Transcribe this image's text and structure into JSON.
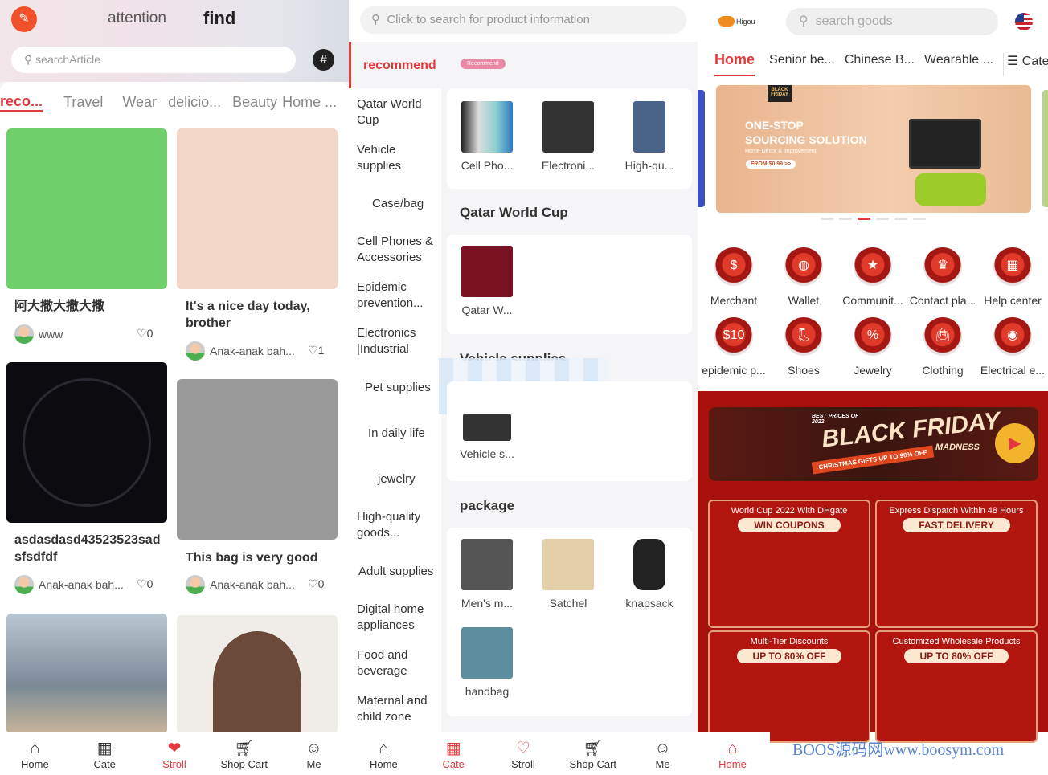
{
  "discover": {
    "header": {
      "tab_attention": "attention",
      "tab_find": "find",
      "search_placeholder": "searchArticle"
    },
    "categories": [
      "reco...",
      "Travel",
      "Wear",
      "delicio...",
      "Beauty",
      "Home ..."
    ],
    "posts": [
      {
        "title": "阿大撒大撒大撒",
        "author": "www",
        "likes": "0",
        "color": "#6fcf6a"
      },
      {
        "title": "It's a nice day today, brother",
        "author": "Anak-anak bah...",
        "likes": "1",
        "color": "#f1d6c6"
      },
      {
        "title": "asdasdasd43523523sadsfsdfdf",
        "author": "Anak-anak bah...",
        "likes": "0",
        "color": "#0c0c10"
      },
      {
        "title": "This bag is very good",
        "author": "Anak-anak bah...",
        "likes": "0",
        "color": "#9a9a9a"
      },
      {
        "title": "",
        "author": "",
        "likes": "",
        "color": "#7a8a96"
      },
      {
        "title": "",
        "author": "",
        "likes": "",
        "color": "#d9cfc8"
      }
    ],
    "nav": [
      {
        "label": "Home",
        "icon": "home-icon"
      },
      {
        "label": "Cate",
        "icon": "grid-icon"
      },
      {
        "label": "Stroll",
        "icon": "heart-icon",
        "active": true
      },
      {
        "label": "Shop Cart",
        "icon": "cart-icon"
      },
      {
        "label": "Me",
        "icon": "user-icon"
      }
    ]
  },
  "category": {
    "search_placeholder": "Click to search for product information",
    "sidebar": [
      "recommend",
      "Qatar World Cup",
      "Vehicle supplies",
      "Case/bag",
      "Cell Phones & Accessories",
      "Epidemic prevention...",
      "Electronics |Industrial",
      "Pet supplies",
      "In daily life",
      "jewelry",
      "High-quality goods...",
      "Adult supplies",
      "Digital home appliances",
      "Food and beverage",
      "Maternal and child zone"
    ],
    "badge": "Recommend",
    "sections": [
      {
        "title": "",
        "items": [
          "Cell Pho...",
          "Electroni...",
          "High-qu..."
        ]
      },
      {
        "title": "Qatar World Cup",
        "items": [
          "Qatar W..."
        ]
      },
      {
        "title": "Vehicle supplies",
        "items": [
          "Vehicle s..."
        ]
      },
      {
        "title": "package",
        "items": [
          "Men's m...",
          "Satchel",
          "knapsack",
          "handbag"
        ]
      }
    ],
    "nav": [
      {
        "label": "Home",
        "icon": "home-icon"
      },
      {
        "label": "Cate",
        "icon": "grid-icon",
        "active": true
      },
      {
        "label": "Stroll",
        "icon": "heart-icon"
      },
      {
        "label": "Shop Cart",
        "icon": "cart-icon"
      },
      {
        "label": "Me",
        "icon": "user-icon"
      }
    ]
  },
  "home": {
    "logo": "Higou",
    "search_placeholder": "search goods",
    "tabs": [
      "Home",
      "Senior be...",
      "Chinese B...",
      "Wearable ...",
      "Cate"
    ],
    "banner": {
      "badge": "BLACK FRIDAY",
      "line1": "ONE-STOP",
      "line2": "SOURCING SOLUTION",
      "sub": "Home Décor & Improvement",
      "cta": "FROM $0.99 >>",
      "slides": 6,
      "active_slide": 3
    },
    "shortcuts": [
      "Merchant",
      "Wallet",
      "Communit...",
      "Contact pla...",
      "Help center",
      "epidemic p...",
      "Shoes",
      "Jewelry",
      "Clothing",
      "Electrical e..."
    ],
    "black_friday": {
      "tag": "BEST PRICES OF 2022",
      "title": "BLACK FRIDAY",
      "sub": "MADNESS",
      "ribbon": "CHRISTMAS GIFTS UP TO 90% OFF"
    },
    "promos": [
      {
        "title": "World Cup 2022 With DHgate",
        "badge": "WIN COUPONS"
      },
      {
        "title": "Express Dispatch Within 48 Hours",
        "badge": "FAST DELIVERY"
      },
      {
        "title": "Multi-Tier Discounts",
        "badge": "UP TO 80% OFF"
      },
      {
        "title": "Customized Wholesale Products",
        "badge": "UP TO 80% OFF"
      }
    ],
    "nav": [
      {
        "label": "Home",
        "icon": "home-icon",
        "active": true
      }
    ],
    "accent": "#e4393c"
  },
  "watermark": "BOOS源码网www.boosym.com"
}
